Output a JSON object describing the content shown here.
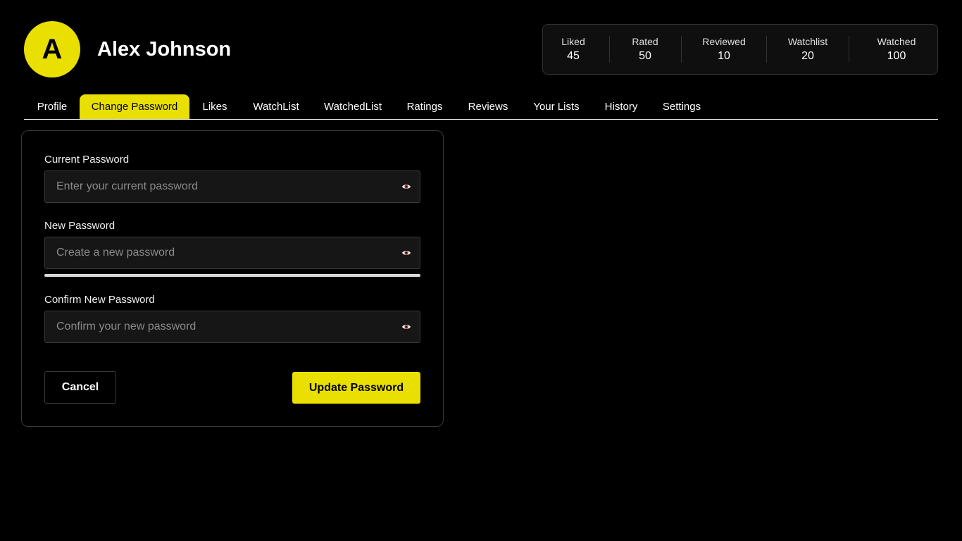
{
  "user": {
    "avatar_initial": "A",
    "name": "Alex Johnson"
  },
  "stats": [
    {
      "label": "Liked",
      "value": "45"
    },
    {
      "label": "Rated",
      "value": "50"
    },
    {
      "label": "Reviewed",
      "value": "10"
    },
    {
      "label": "Watchlist",
      "value": "20"
    },
    {
      "label": "Watched",
      "value": "100"
    }
  ],
  "tabs": [
    {
      "label": "Profile"
    },
    {
      "label": "Change Password",
      "active": true
    },
    {
      "label": "Likes"
    },
    {
      "label": "WatchList"
    },
    {
      "label": "WatchedList"
    },
    {
      "label": "Ratings"
    },
    {
      "label": "Reviews"
    },
    {
      "label": "Your Lists"
    },
    {
      "label": "History"
    },
    {
      "label": "Settings"
    }
  ],
  "form": {
    "current": {
      "label": "Current Password",
      "placeholder": "Enter your current password",
      "value": ""
    },
    "new": {
      "label": "New Password",
      "placeholder": "Create a new password",
      "value": ""
    },
    "confirm": {
      "label": "Confirm New Password",
      "placeholder": "Confirm your new password",
      "value": ""
    },
    "cancel_label": "Cancel",
    "submit_label": "Update Password"
  },
  "icons": {
    "toggle_visibility": "eye-icon"
  },
  "colors": {
    "accent": "#e9df00",
    "background": "#000000",
    "input_bg": "#161616",
    "border": "#3a3a3a",
    "eye_iris": "#b8321e"
  }
}
